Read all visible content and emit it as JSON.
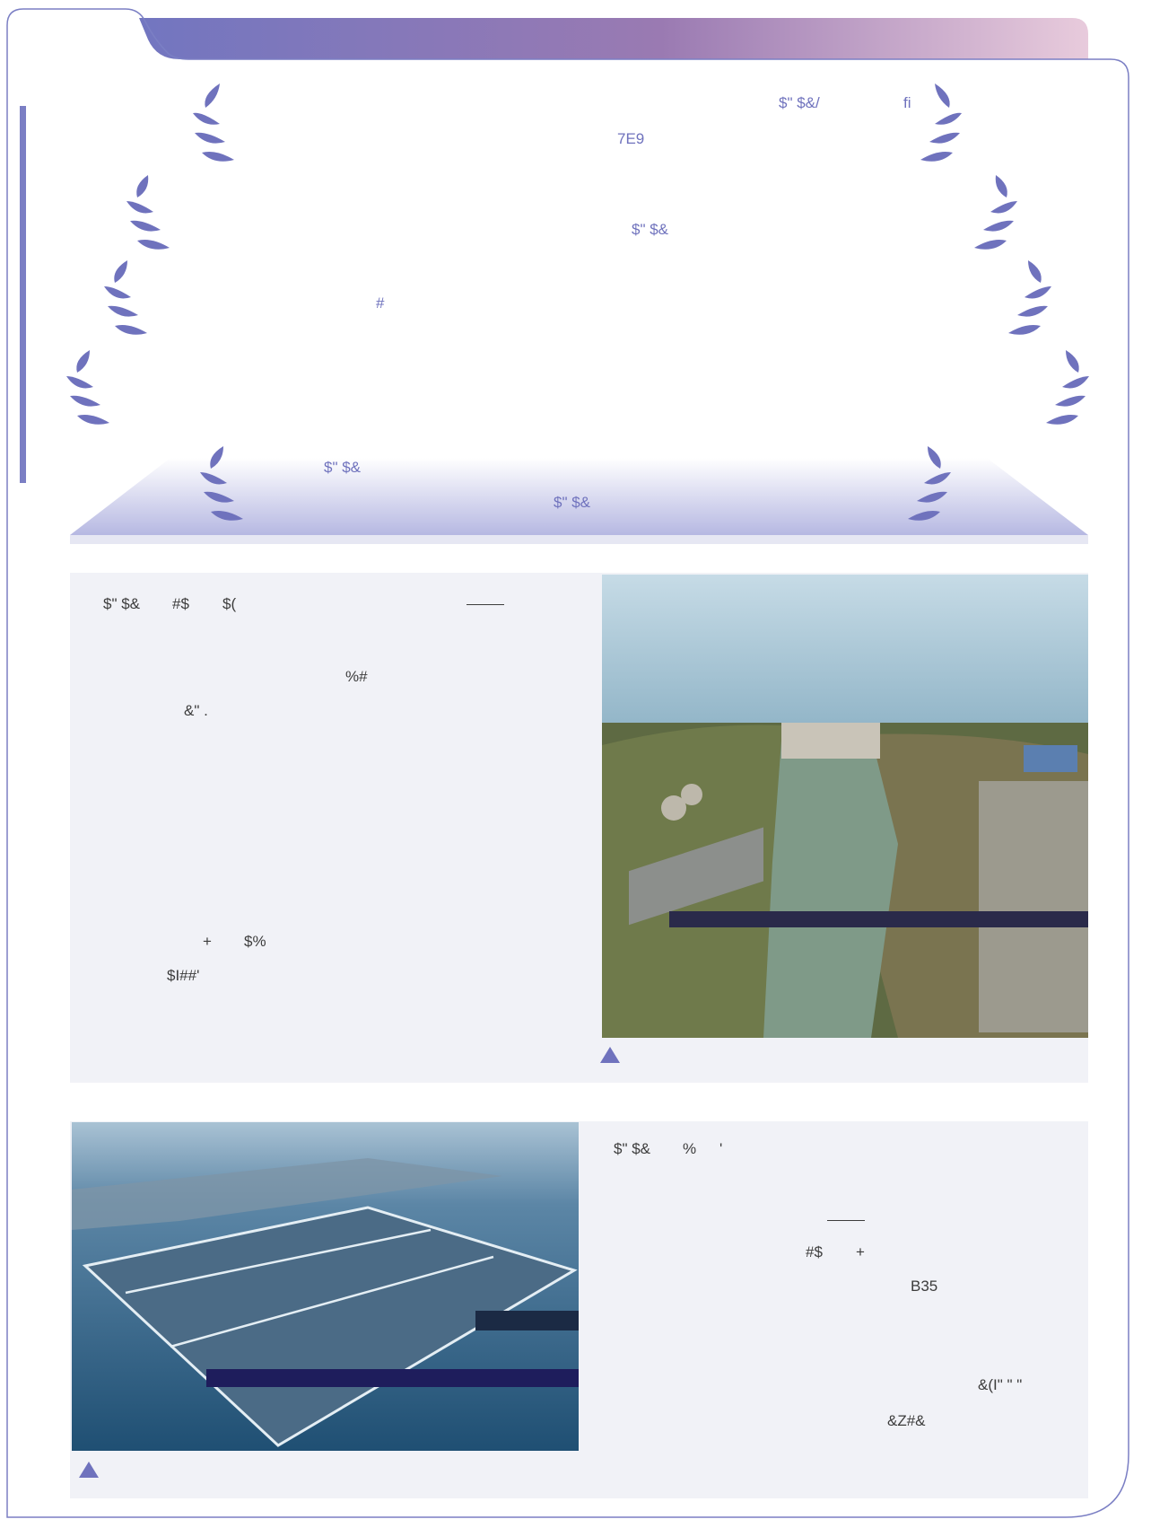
{
  "header": {
    "line1_a": "$\" $&/",
    "line1_b": "fi",
    "line2": "7E9",
    "line3": "$\" $&",
    "line4": "#",
    "banner_line1": "$\" $&",
    "banner_line2": "$\" $&"
  },
  "section1": {
    "lines": [
      "$\" $&",
      "#$",
      "$(",
      "%#",
      "&\" ."
    ],
    "lower_lines": [
      "+",
      "$%",
      "$I##'"
    ],
    "photo_caption_icon": "triangle-icon"
  },
  "section2": {
    "lines": [
      "$\" $&",
      "%",
      "'"
    ],
    "mid_lines": [
      "#$",
      "+",
      "B35"
    ],
    "lower_lines": [
      "&(I\" \" \"",
      "&Z#&"
    ],
    "photo_caption_icon": "triangle-icon"
  },
  "colors": {
    "accent": "#6f72bd",
    "card_bg": "#f1f2f7",
    "header_grad_start": "#7276c0",
    "header_grad_end": "#e6c7da"
  }
}
